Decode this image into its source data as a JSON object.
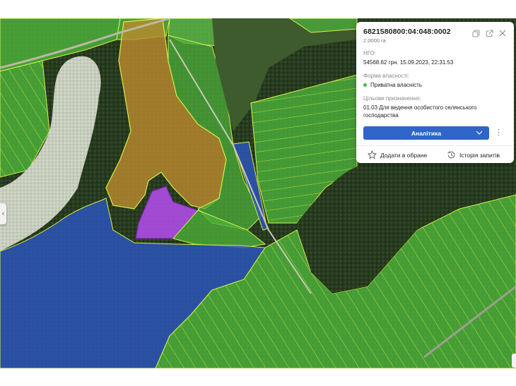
{
  "parcel": {
    "cadastral_number": "6821580800:04:048:0002",
    "area": "2.0000 га",
    "ngo_label": "НГО:",
    "ngo_value": "54568.62 грн. 15.09.2023, 22:31:53",
    "ownership_label": "Форма власності:",
    "ownership_value": "Приватна власність",
    "ownership_color": "#49b84f",
    "purpose_label": "Цільове призначення:",
    "purpose_value": "01.03 Для ведення особистого селянського господарства"
  },
  "actions": {
    "analytics_label": "Аналітика",
    "more_icon": "⋮",
    "favorite_label": "Додати в обране",
    "history_label": "Історія запитів",
    "copy_icon": "copy-icon",
    "open_external_icon": "external-link-icon",
    "close_icon": "close-icon",
    "star_icon": "star-icon",
    "history_icon": "history-icon",
    "accent_color": "#2f66c7"
  },
  "map": {
    "side_handle_icon": "‹",
    "layer_colors": {
      "private_parcels": "#4caf3a",
      "state_parcels": "#2c55b8",
      "brown_parcels": "#b98a2e",
      "selected_parcel": "#b04be6",
      "parcel_border": "#d8f04a"
    }
  }
}
